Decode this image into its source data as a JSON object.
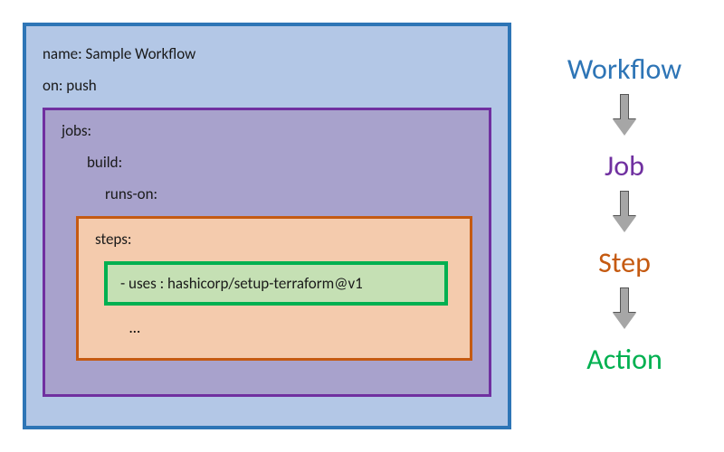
{
  "workflow": {
    "name_line": "name: Sample Workflow",
    "on_line": "on: push"
  },
  "jobs": {
    "label": "jobs:",
    "build_line": "build:",
    "runs_on_line": "runs-on:"
  },
  "steps": {
    "label": "steps:",
    "ellipsis": "…"
  },
  "action": {
    "uses_line": "- uses : hashicorp/setup-terraform@v1"
  },
  "legend": {
    "workflow": "Workflow",
    "job": "Job",
    "step": "Step",
    "action": "Action"
  }
}
